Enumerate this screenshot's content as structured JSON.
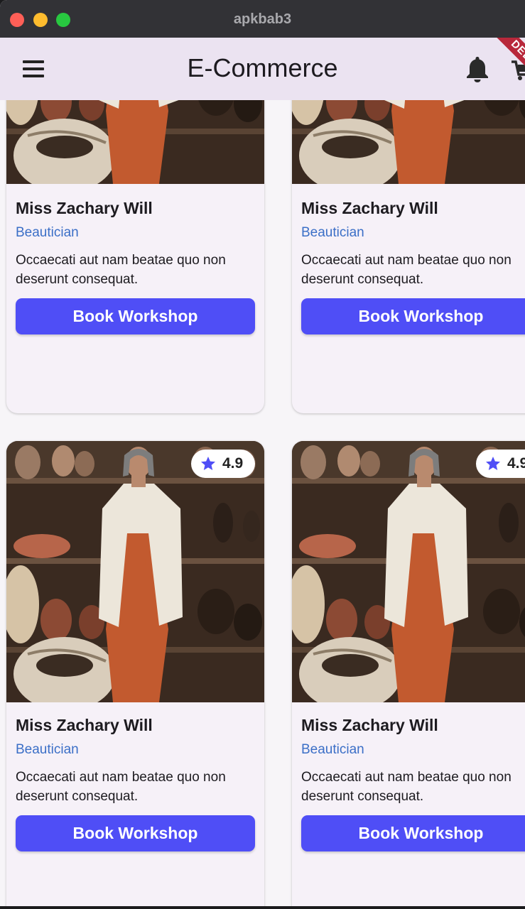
{
  "window": {
    "title": "apkbab3"
  },
  "appbar": {
    "title": "E-Commerce",
    "menu_icon": "hamburger-menu-icon",
    "notification_icon": "bell-icon",
    "cart_icon": "cart-icon",
    "debug_banner": "DEBUG"
  },
  "colors": {
    "appbar_bg": "#ebe3f1",
    "button_bg": "#4f4ef6",
    "role_text": "#3b6fc7",
    "card_bg": "#f6f1f8"
  },
  "cards": [
    {
      "name": "Miss Zachary Will",
      "role": "Beautician",
      "description": "Occaecati aut nam beatae quo non deserunt consequat.",
      "button": "Book Workshop"
    },
    {
      "name": "Miss Zachary Will",
      "role": "Beautician",
      "description": "Occaecati aut nam beatae quo non deserunt consequat.",
      "button": "Book Workshop"
    },
    {
      "name": "Miss Zachary Will",
      "role": "Beautician",
      "description": "Occaecati aut nam beatae quo non deserunt consequat.",
      "button": "Book Workshop",
      "rating": "4.9",
      "rating_icon": "star-icon"
    },
    {
      "name": "Miss Zachary Will",
      "role": "Beautician",
      "description": "Occaecati aut nam beatae quo non deserunt consequat.",
      "button": "Book Workshop",
      "rating": "4.9",
      "rating_icon": "star-icon"
    }
  ]
}
